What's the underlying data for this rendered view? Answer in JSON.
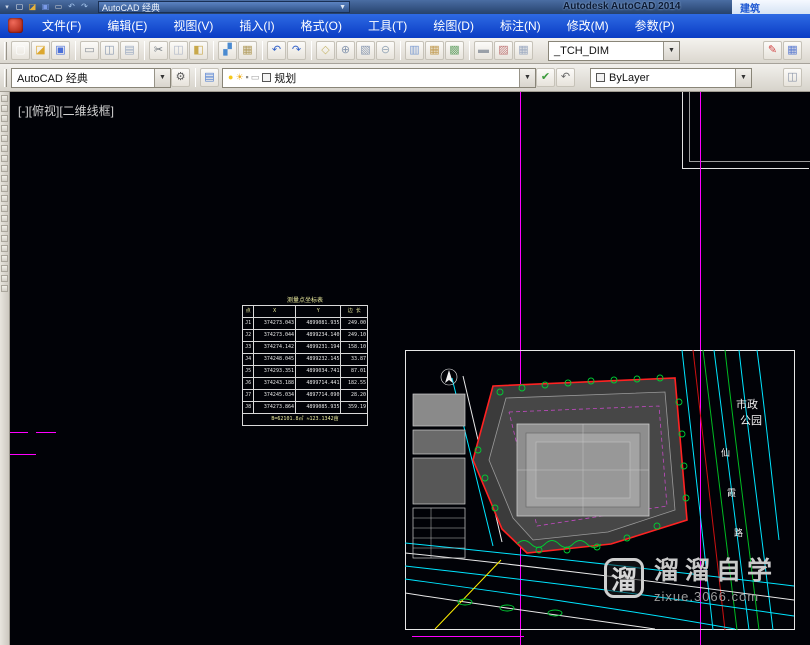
{
  "colors": {
    "menu_blue": "#0c41cf",
    "canvas_bg": "#010207",
    "construction_magenta": "#ff00ff",
    "boundary_red": "#ff2222",
    "road_cyan": "#00e5ff",
    "landscape_green": "#00cc33"
  },
  "titlebar": {
    "workspace": "AutoCAD 经典",
    "app_title": "Autodesk AutoCAD 2014",
    "doc": "建筑",
    "qat_icons": [
      {
        "name": "new-icon",
        "glyph": "▢",
        "color": "#f0f0f0"
      },
      {
        "name": "open-icon",
        "glyph": "◪",
        "color": "#e8b23a"
      },
      {
        "name": "save-icon",
        "glyph": "▣",
        "color": "#7a9ae8"
      },
      {
        "name": "plot-icon",
        "glyph": "▭",
        "color": "#d0d0d0"
      },
      {
        "name": "undo-icon",
        "glyph": "↶",
        "color": "#a8c8f0"
      },
      {
        "name": "redo-icon",
        "glyph": "↷",
        "color": "#a8c8f0"
      }
    ]
  },
  "menubar": {
    "items": [
      "文件(F)",
      "编辑(E)",
      "视图(V)",
      "插入(I)",
      "格式(O)",
      "工具(T)",
      "绘图(D)",
      "标注(N)",
      "修改(M)",
      "参数(P)"
    ]
  },
  "std_toolbar": {
    "icons": [
      {
        "name": "new-icon",
        "glyph": "▢",
        "color": "#fdfdfd"
      },
      {
        "name": "open-icon",
        "glyph": "◪",
        "color": "#dca72e"
      },
      {
        "name": "save-icon",
        "glyph": "▣",
        "color": "#4a6fd9"
      },
      "|",
      {
        "name": "plot-icon",
        "glyph": "▭",
        "color": "#8a9098"
      },
      {
        "name": "plot-preview-icon",
        "glyph": "◫",
        "color": "#8898b0"
      },
      {
        "name": "publish-icon",
        "glyph": "▤",
        "color": "#98a8c0"
      },
      "|",
      {
        "name": "cut-icon",
        "glyph": "✂",
        "color": "#687078"
      },
      {
        "name": "copy-icon",
        "glyph": "◫",
        "color": "#b0b8c8"
      },
      {
        "name": "paste-icon",
        "glyph": "◧",
        "color": "#c8a84a"
      },
      "|",
      {
        "name": "match-properties-icon",
        "glyph": "▞",
        "color": "#4a8ad0"
      },
      {
        "name": "block-editor-icon",
        "glyph": "▦",
        "color": "#b09a5a"
      },
      "|",
      {
        "name": "undo-icon",
        "glyph": "↶",
        "color": "#2f5fc8"
      },
      {
        "name": "redo-icon",
        "glyph": "↷",
        "color": "#2f5fc8"
      },
      "|",
      {
        "name": "pan-icon",
        "glyph": "◇",
        "color": "#c8b870"
      },
      {
        "name": "zoom-realtime-icon",
        "glyph": "⊕",
        "color": "#8898b0"
      },
      {
        "name": "zoom-window-icon",
        "glyph": "▧",
        "color": "#8898b0"
      },
      {
        "name": "zoom-previous-icon",
        "glyph": "⊖",
        "color": "#98a8b8"
      },
      "|",
      {
        "name": "properties-icon",
        "glyph": "▥",
        "color": "#7a9ad0"
      },
      {
        "name": "designcenter-icon",
        "glyph": "▦",
        "color": "#c09a50"
      },
      {
        "name": "tool-palettes-icon",
        "glyph": "▩",
        "color": "#70a870"
      },
      "|",
      {
        "name": "sheetset-manager-icon",
        "glyph": "▬",
        "color": "#9aa0a8"
      },
      {
        "name": "markup-icon",
        "glyph": "▨",
        "color": "#c07878"
      },
      {
        "name": "quickcalc-icon",
        "glyph": "▦",
        "color": "#9aa8c0"
      }
    ],
    "dim_style": "_TCH_DIM",
    "right_icons": [
      {
        "name": "annotate-pencil-icon",
        "glyph": "✎",
        "color": "#d04040"
      },
      {
        "name": "table-style-icon",
        "glyph": "▦",
        "color": "#5a7ad0"
      }
    ]
  },
  "layers_toolbar": {
    "workspace": "AutoCAD 经典",
    "pre_icons": [
      {
        "name": "gear-icon",
        "glyph": "⚙",
        "color": "#5a5a5a"
      },
      "|",
      {
        "name": "layer-properties-icon",
        "glyph": "▤",
        "color": "#4a7ad0"
      }
    ],
    "status_icons": [
      {
        "name": "layer-on-bulb-icon",
        "glyph": "●",
        "color": "#f5c81a"
      },
      {
        "name": "layer-freeze-sun-icon",
        "glyph": "☀",
        "color": "#f0b020"
      },
      {
        "name": "layer-lock-icon",
        "glyph": "▪",
        "color": "#8a8a8a"
      },
      {
        "name": "layer-plot-icon",
        "glyph": "▭",
        "color": "#9a9a9a"
      }
    ],
    "layer_value": "规划",
    "mid_icons": [
      {
        "name": "make-current-icon",
        "glyph": "✔",
        "color": "#3a9a3a"
      },
      {
        "name": "layer-previous-icon",
        "glyph": "↶",
        "color": "#666666"
      }
    ],
    "color_value": "ByLayer",
    "trail_icons": [
      {
        "name": "draw-order-icon",
        "glyph": "◫",
        "color": "#8a94a8"
      }
    ]
  },
  "canvas": {
    "viewport_minus": "[-]",
    "viewport_view": "[俯视]",
    "viewport_style": "[二维线框]"
  },
  "coord_table": {
    "title": "测量点坐标表",
    "headers": [
      "点",
      "X",
      "Y",
      "边 长"
    ],
    "rows": [
      [
        "J1",
        "374273.043",
        "4899081.935",
        "249.00"
      ],
      [
        "J2",
        "374273.044",
        "4899234.140",
        "249.10"
      ],
      [
        "J3",
        "374274.142",
        "4899231.194",
        "158.10"
      ],
      [
        "J4",
        "374248.045",
        "4899232.145",
        "33.87"
      ],
      [
        "J5",
        "374293.351",
        "4899034.741",
        "87.01"
      ],
      [
        "J6",
        "374243.188",
        "4899714.441",
        "182.55"
      ],
      [
        "J7",
        "374245.034",
        "4897714.090",
        "28.20"
      ],
      [
        "J8",
        "374273.864",
        "4899085.935",
        "359.19"
      ]
    ],
    "footer": "B=62101.8㎡ ≈123.1342亩"
  },
  "site_plan": {
    "park_line1": "市政",
    "park_line2": "公园",
    "road_chars": [
      "仙",
      "霞",
      "路"
    ]
  },
  "watermark": {
    "logo_char": "溜",
    "title": "溜溜自学",
    "url": "zixue.3066.com"
  }
}
